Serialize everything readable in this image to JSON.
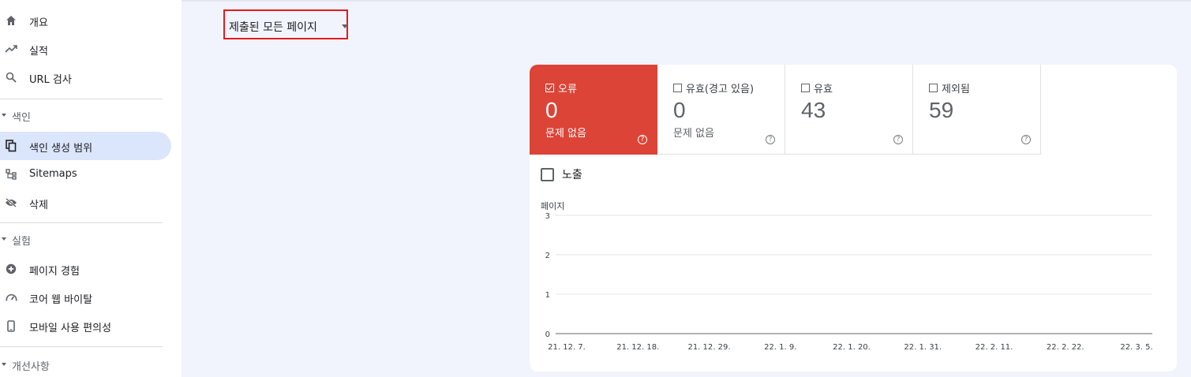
{
  "sidebar": {
    "items_top": [
      {
        "label": "개요",
        "icon": "home-icon"
      },
      {
        "label": "실적",
        "icon": "trending-up-icon"
      },
      {
        "label": "URL 검사",
        "icon": "search-icon"
      }
    ],
    "section_index": {
      "label": "색인"
    },
    "items_index": [
      {
        "label": "색인 생성 범위",
        "icon": "copy-icon",
        "active": true
      },
      {
        "label": "Sitemaps",
        "icon": "sitemap-icon"
      },
      {
        "label": "삭제",
        "icon": "visibility-off-icon"
      }
    ],
    "section_experience": {
      "label": "실험"
    },
    "items_experience": [
      {
        "label": "페이지 경험",
        "icon": "add-circle-icon"
      },
      {
        "label": "코어 웹 바이탈",
        "icon": "speed-icon"
      },
      {
        "label": "모바일 사용 편의성",
        "icon": "phone-icon"
      }
    ],
    "section_enhancements": {
      "label": "개선사항"
    }
  },
  "filter": {
    "selected": "제출된 모든 페이지"
  },
  "tiles": [
    {
      "label": "오류",
      "value": "0",
      "sub": "문제 없음",
      "checked": true,
      "color": "#db4437"
    },
    {
      "label": "유효(경고 있음)",
      "value": "0",
      "sub": "문제 없음",
      "checked": false
    },
    {
      "label": "유효",
      "value": "43",
      "sub": "",
      "checked": false
    },
    {
      "label": "제외됨",
      "value": "59",
      "sub": "",
      "checked": false
    }
  ],
  "impressions": {
    "label": "노출",
    "checked": false
  },
  "chart_data": {
    "type": "line",
    "ylabel": "페이지",
    "ylim": [
      0,
      3
    ],
    "yticks": [
      "0",
      "1",
      "2",
      "3"
    ],
    "x_ticks": [
      "21. 12. 7.",
      "21. 12. 18.",
      "21. 12. 29.",
      "22. 1. 9.",
      "22. 1. 20.",
      "22. 1. 31.",
      "22. 2. 11.",
      "22. 2. 22.",
      "22. 3. 5."
    ],
    "series": [
      {
        "values": [
          0,
          0,
          0,
          0,
          0,
          0,
          0,
          0,
          0
        ],
        "color": "#5f6368"
      }
    ],
    "grid": true
  }
}
